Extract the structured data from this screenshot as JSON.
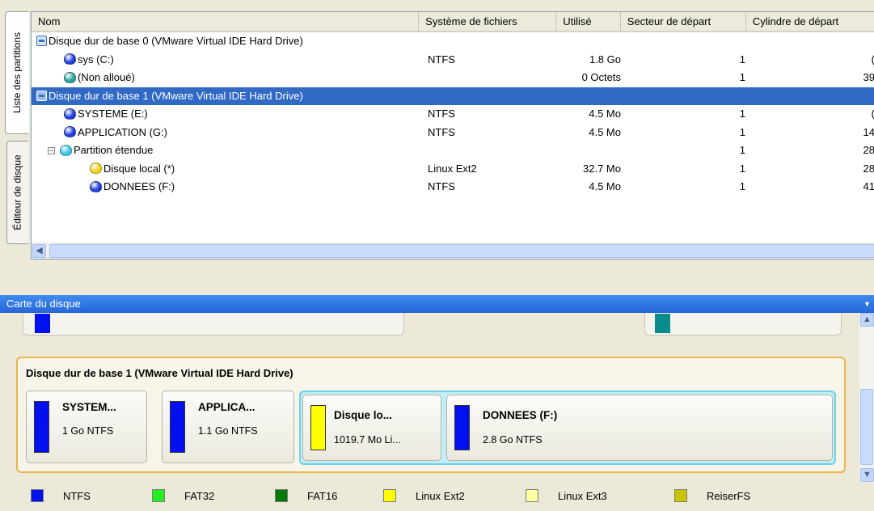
{
  "tabs": {
    "partition_list": "Liste des partitions",
    "disk_editor": "Éditeur de disque"
  },
  "table": {
    "headers": [
      "Nom",
      "Système de fichiers",
      "Utilisé",
      "Secteur de départ",
      "Cylindre de départ"
    ],
    "rows": [
      {
        "name": "Disque dur de base 0 (VMware Virtual IDE Hard Drive)",
        "fs": "",
        "used": "",
        "sector": "",
        "cylinder": "",
        "kind": "disk",
        "selected": false
      },
      {
        "name": "sys (C:)",
        "fs": "NTFS",
        "used": "1.8 Go",
        "sector": "1",
        "cylinder": "(",
        "kind": "part",
        "color": "#1f3fdc"
      },
      {
        "name": "(Non alloué)",
        "fs": "",
        "used": "0 Octets",
        "sector": "1",
        "cylinder": "39",
        "kind": "part",
        "color": "#2aa59a"
      },
      {
        "name": "Disque dur de base 1 (VMware Virtual IDE Hard Drive)",
        "fs": "",
        "used": "",
        "sector": "",
        "cylinder": "",
        "kind": "disk",
        "selected": true
      },
      {
        "name": "SYSTEME (E:)",
        "fs": "NTFS",
        "used": "4.5 Mo",
        "sector": "1",
        "cylinder": "(",
        "kind": "part",
        "color": "#1f3fdc"
      },
      {
        "name": "APPLICATION (G:)",
        "fs": "NTFS",
        "used": "4.5 Mo",
        "sector": "1",
        "cylinder": "14",
        "kind": "part",
        "color": "#1f3fdc"
      },
      {
        "name": "Partition étendue",
        "fs": "",
        "used": "",
        "sector": "1",
        "cylinder": "28",
        "kind": "ext",
        "color": "#39c6e8"
      },
      {
        "name": "Disque local (*)",
        "fs": "Linux Ext2",
        "used": "32.7 Mo",
        "sector": "1",
        "cylinder": "28",
        "kind": "sub",
        "color": "#f2d21a"
      },
      {
        "name": "DONNEES (F:)",
        "fs": "NTFS",
        "used": "4.5 Mo",
        "sector": "1",
        "cylinder": "41",
        "kind": "sub",
        "color": "#1f3fdc"
      }
    ],
    "expander": "⊟"
  },
  "disk_map": {
    "title": "Carte du disque",
    "disk1_title": "Disque dur de base 1 (VMware Virtual IDE Hard Drive)",
    "partitions": [
      {
        "name": "SYSTEM...",
        "info": "1 Go NTFS",
        "color": "#0010ee"
      },
      {
        "name": "APPLICA...",
        "info": "1.1 Go NTFS",
        "color": "#0010ee"
      },
      {
        "name": "Disque lo...",
        "info": "1019.7 Mo Li...",
        "color": "#ffff00"
      },
      {
        "name": "DONNEES (F:)",
        "info": "2.8 Go NTFS",
        "color": "#0010ee"
      }
    ]
  },
  "legend": [
    {
      "label": "NTFS",
      "color": "#0010ee"
    },
    {
      "label": "FAT32",
      "color": "#22ee22"
    },
    {
      "label": "FAT16",
      "color": "#007a00"
    },
    {
      "label": "Linux Ext2",
      "color": "#ffff00"
    },
    {
      "label": "Linux Ext3",
      "color": "#ffffa0"
    },
    {
      "label": "ReiserFS",
      "color": "#c8c400"
    }
  ]
}
